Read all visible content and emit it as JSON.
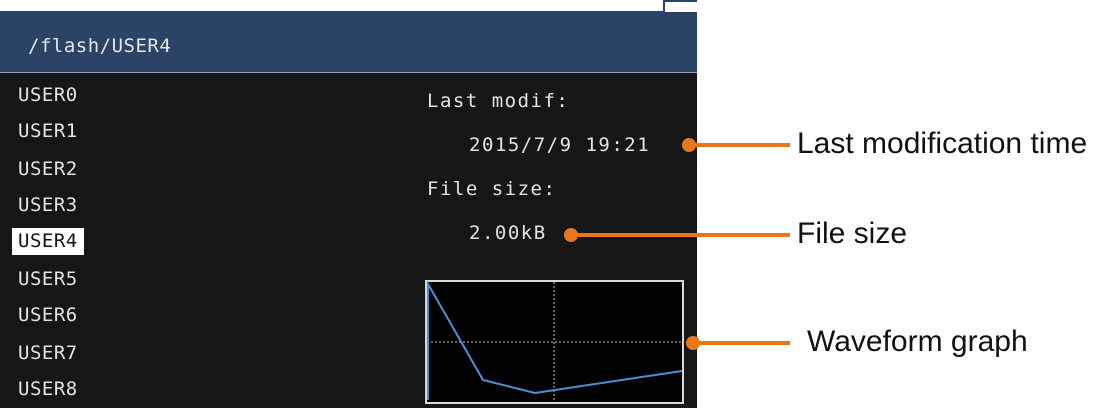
{
  "header": {
    "path": "/flash/USER4"
  },
  "file_list": {
    "items": [
      {
        "label": "USER0",
        "selected": false
      },
      {
        "label": "USER1",
        "selected": false
      },
      {
        "label": "USER2",
        "selected": false
      },
      {
        "label": "USER3",
        "selected": false
      },
      {
        "label": "USER4",
        "selected": true
      },
      {
        "label": "USER5",
        "selected": false
      },
      {
        "label": "USER6",
        "selected": false
      },
      {
        "label": "USER7",
        "selected": false
      },
      {
        "label": "USER8",
        "selected": false
      }
    ]
  },
  "info": {
    "last_modif_label": "Last modif:",
    "last_modif_value": "2015/7/9 19:21",
    "file_size_label": "File size:",
    "file_size_value": "2.00kB"
  },
  "callouts": {
    "last_modification": "Last modification time",
    "file_size": "File size",
    "waveform": "Waveform graph"
  },
  "colors": {
    "screen_background": "#161616",
    "path_bar": "#2b4366",
    "waveform": "#4a90d9",
    "callout": "#e8771c"
  }
}
